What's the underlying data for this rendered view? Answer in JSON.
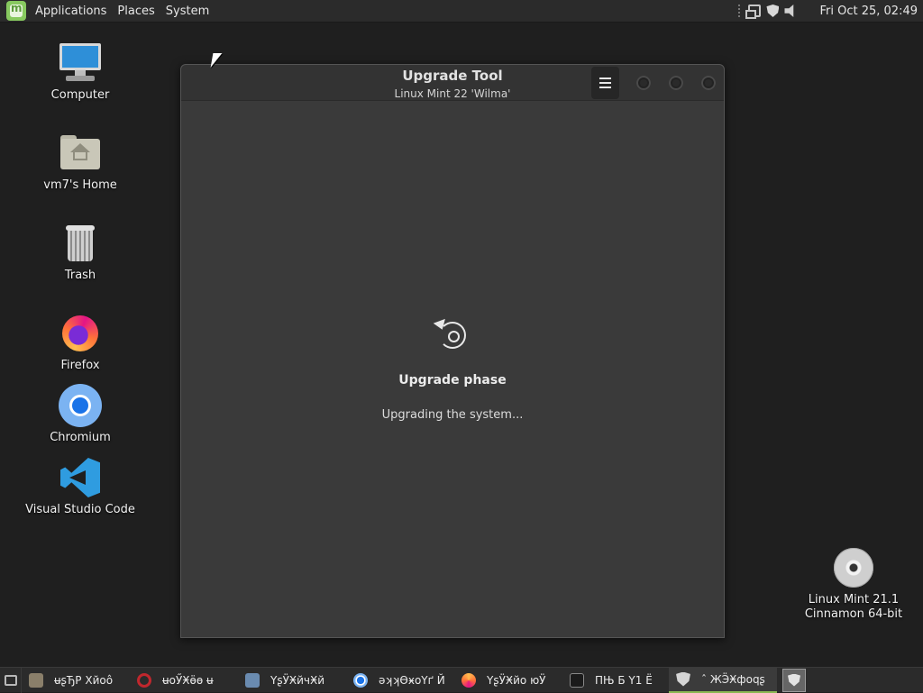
{
  "top_panel": {
    "menus": [
      "Applications",
      "Places",
      "System"
    ],
    "tray_icons": [
      "network-icon",
      "shield-icon",
      "volume-icon"
    ],
    "clock": "Fri Oct 25, 02:49"
  },
  "desktop": {
    "icons": [
      {
        "label": "Computer",
        "icon": "computer-icon"
      },
      {
        "label": "vm7's Home",
        "icon": "home-folder-icon"
      },
      {
        "label": "Trash",
        "icon": "trash-icon"
      },
      {
        "label": "Firefox",
        "icon": "firefox-icon"
      },
      {
        "label": "Chromium",
        "icon": "chromium-icon"
      },
      {
        "label": "Visual Studio Code",
        "icon": "vscode-icon"
      }
    ],
    "disc": {
      "line1": "Linux Mint 21.1",
      "line2": "Cinnamon 64-bit",
      "icon": "disc-icon"
    }
  },
  "window": {
    "title": "Upgrade Tool",
    "subtitle": "Linux Mint 22 'Wilma'",
    "phase_title": "Upgrade phase",
    "phase_status": "Upgrading the system..."
  },
  "taskbar": {
    "tasks": [
      {
        "label": "ʉʂЂР Хйoô",
        "icon": "file-manager-icon",
        "active": false
      },
      {
        "label": "ʉоӲӾӫө ʉ",
        "icon": "opera-icon",
        "active": false
      },
      {
        "label": "ҮʂӰӾйчӾй",
        "icon": "disk-icon",
        "active": false
      },
      {
        "label": "ǝʞʞӨӿоҮґ Й",
        "icon": "chromium-icon",
        "active": false
      },
      {
        "label": "ҮʂӰӾйо юӰ",
        "icon": "firefox-icon",
        "active": false
      },
      {
        "label": "ПЊ  Б Ү1 Ё",
        "icon": "terminal-icon",
        "active": false
      },
      {
        "label": "ˆ ЖӬӾфоqʂ",
        "icon": "shield-icon",
        "active": true
      }
    ]
  },
  "colors": {
    "panel": "#2b2b2b",
    "desktop": "#1f1f1f",
    "window_bg": "#3a3a3a",
    "accent_green": "#8ab853"
  }
}
